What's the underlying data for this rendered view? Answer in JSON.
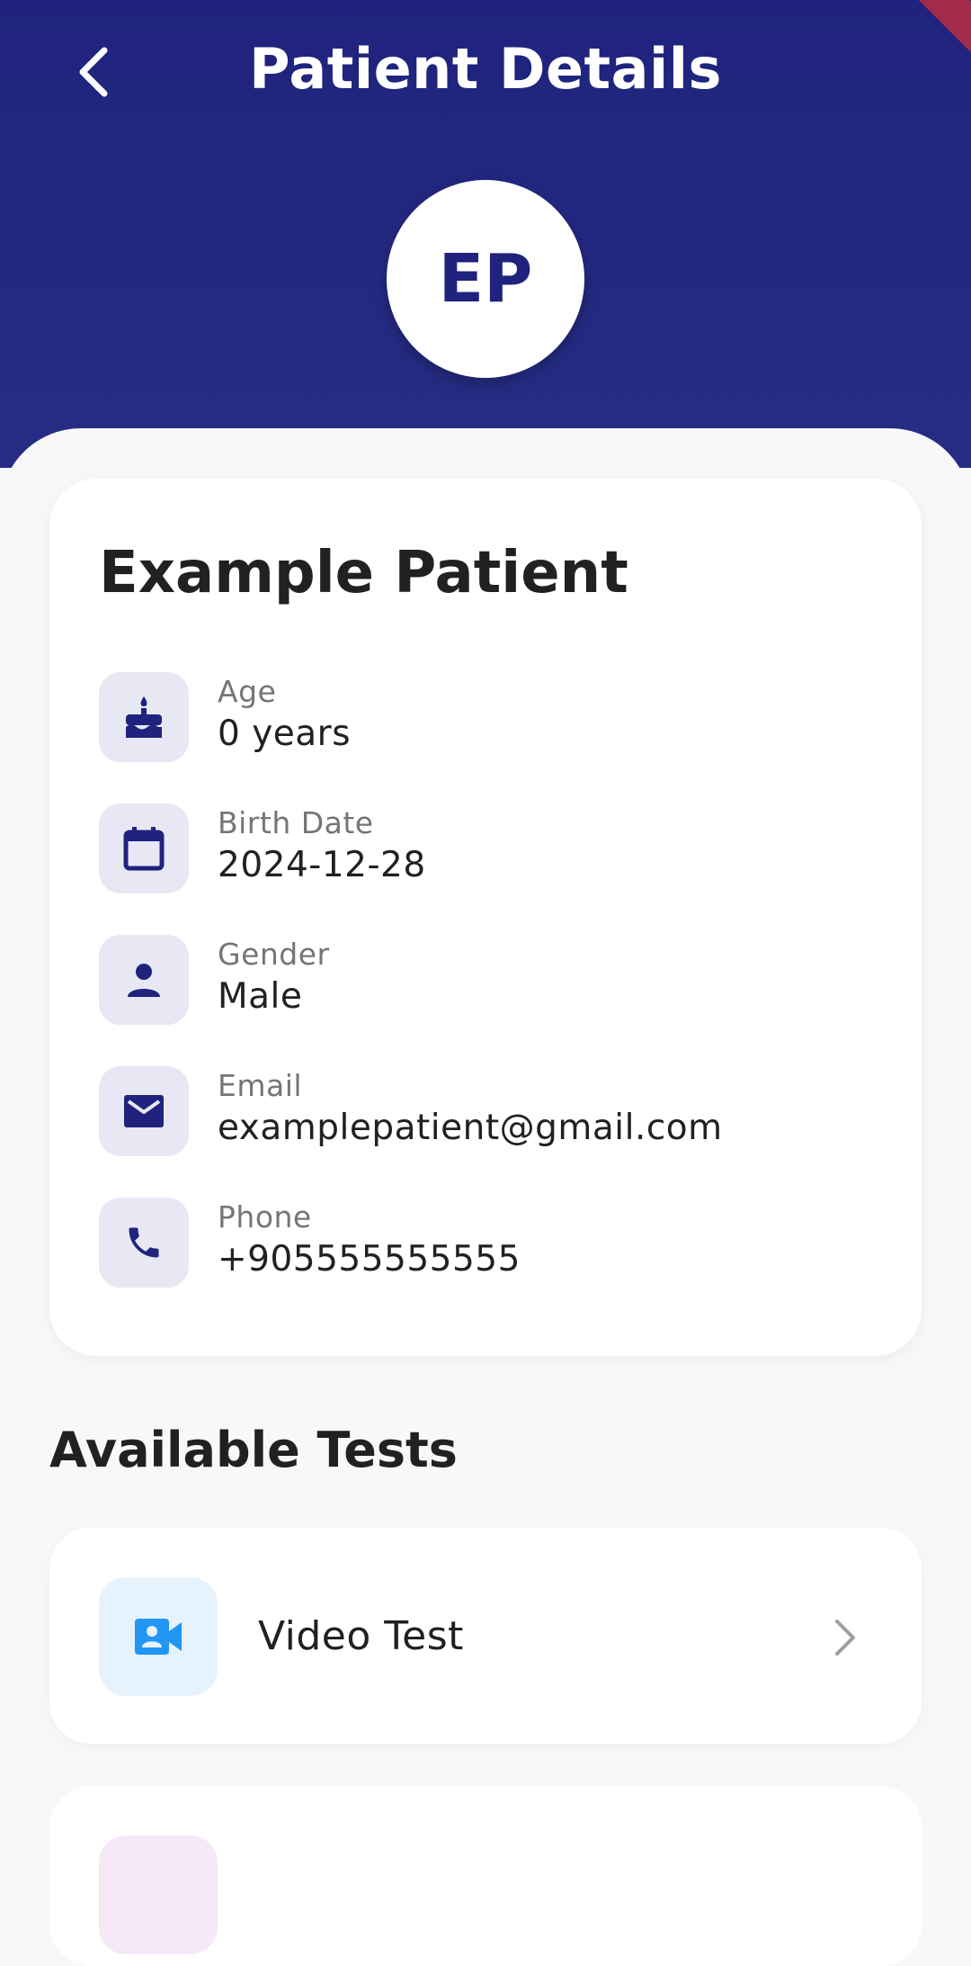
{
  "header": {
    "title": "Patient Details",
    "avatar_initials": "EP",
    "back_icon": "chevron-left-icon"
  },
  "patient": {
    "name": "Example Patient",
    "fields": [
      {
        "icon": "cake-icon",
        "label": "Age",
        "value": "0 years"
      },
      {
        "icon": "calendar-icon",
        "label": "Birth Date",
        "value": "2024-12-28"
      },
      {
        "icon": "person-icon",
        "label": "Gender",
        "value": "Male"
      },
      {
        "icon": "mail-icon",
        "label": "Email",
        "value": "examplepatient@gmail.com"
      },
      {
        "icon": "phone-icon",
        "label": "Phone",
        "value": "+905555555555"
      }
    ]
  },
  "tests": {
    "section_title": "Available Tests",
    "items": [
      {
        "icon": "video-contact-icon",
        "label": "Video Test"
      }
    ]
  },
  "colors": {
    "primary": "#1f237d",
    "icon_bg": "#e8e8f4",
    "video_icon": "#2196f3",
    "video_icon_bg": "#e6f3fd"
  }
}
